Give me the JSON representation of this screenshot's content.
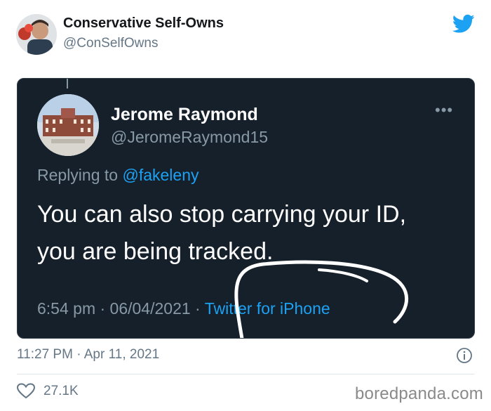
{
  "tweet": {
    "author_name": "Conservative Self-Owns",
    "author_handle": "@ConSelfOwns",
    "timestamp": "11:27 PM · Apr 11, 2021",
    "likes": "27.1K",
    "icons": [
      "avatar",
      "twitter-logo-icon",
      "info-icon",
      "heart-icon"
    ]
  },
  "embedded_tweet": {
    "author_name": "Jerome Raymond",
    "author_handle": "@JeromeRaymond15",
    "replying_prefix": "Replying to",
    "replying_mention": "@fakeleny",
    "text_line1": "You can also stop carrying your ID,",
    "text_line2": "you are being tracked.",
    "meta_time": "6:54 pm · 06/04/2021 · ",
    "meta_source": "Twitter for iPhone",
    "more_label": "•••"
  },
  "watermark": "boredpanda.com",
  "colors": {
    "twitter_blue": "#1da1f2",
    "dark_bg": "#15202b",
    "muted_gray": "#8899a6"
  }
}
